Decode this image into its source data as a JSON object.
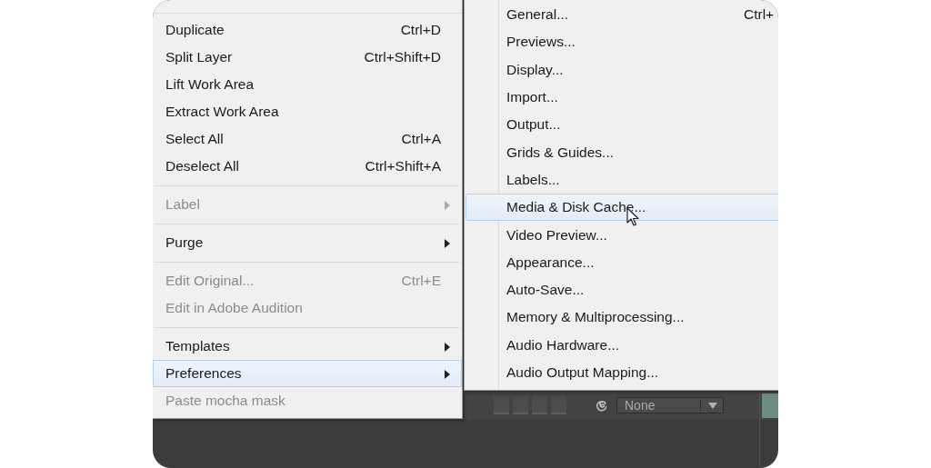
{
  "menu": {
    "items": [
      {
        "kind": "item",
        "label": "Duplicate",
        "shortcut": "Ctrl+D",
        "submenu": false,
        "disabled": false,
        "selected": false
      },
      {
        "kind": "item",
        "label": "Split Layer",
        "shortcut": "Ctrl+Shift+D",
        "submenu": false,
        "disabled": false,
        "selected": false
      },
      {
        "kind": "item",
        "label": "Lift Work Area",
        "submenu": false,
        "disabled": false,
        "selected": false
      },
      {
        "kind": "item",
        "label": "Extract Work Area",
        "submenu": false,
        "disabled": false,
        "selected": false
      },
      {
        "kind": "item",
        "label": "Select All",
        "shortcut": "Ctrl+A",
        "submenu": false,
        "disabled": false,
        "selected": false
      },
      {
        "kind": "item",
        "label": "Deselect All",
        "shortcut": "Ctrl+Shift+A",
        "submenu": false,
        "disabled": false,
        "selected": false
      },
      {
        "kind": "separator"
      },
      {
        "kind": "item",
        "label": "Label",
        "submenu": true,
        "disabled": true,
        "selected": false
      },
      {
        "kind": "separator"
      },
      {
        "kind": "item",
        "label": "Purge",
        "submenu": true,
        "disabled": false,
        "selected": false
      },
      {
        "kind": "separator"
      },
      {
        "kind": "item",
        "label": "Edit Original...",
        "shortcut": "Ctrl+E",
        "submenu": false,
        "disabled": true,
        "selected": false
      },
      {
        "kind": "item",
        "label": "Edit in Adobe Audition",
        "submenu": false,
        "disabled": true,
        "selected": false
      },
      {
        "kind": "separator"
      },
      {
        "kind": "item",
        "label": "Templates",
        "submenu": true,
        "disabled": false,
        "selected": false
      },
      {
        "kind": "item",
        "label": "Preferences",
        "submenu": true,
        "disabled": false,
        "selected": true
      },
      {
        "kind": "item",
        "label": "Paste mocha mask",
        "submenu": false,
        "disabled": true,
        "selected": false
      }
    ]
  },
  "submenu": {
    "items": [
      {
        "label": "General...",
        "shortcut": "Ctrl+",
        "selected": false
      },
      {
        "label": "Previews...",
        "selected": false
      },
      {
        "label": "Display...",
        "selected": false
      },
      {
        "label": "Import...",
        "selected": false
      },
      {
        "label": "Output...",
        "selected": false
      },
      {
        "label": "Grids & Guides...",
        "selected": false
      },
      {
        "label": "Labels...",
        "selected": false
      },
      {
        "label": "Media & Disk Cache...",
        "selected": true
      },
      {
        "label": "Video Preview...",
        "selected": false
      },
      {
        "label": "Appearance...",
        "selected": false
      },
      {
        "label": "Auto-Save...",
        "selected": false
      },
      {
        "label": "Memory & Multiprocessing...",
        "selected": false
      },
      {
        "label": "Audio Hardware...",
        "selected": false
      },
      {
        "label": "Audio Output Mapping...",
        "selected": false
      }
    ]
  },
  "toolbar": {
    "dropdown": {
      "value": "None"
    }
  }
}
